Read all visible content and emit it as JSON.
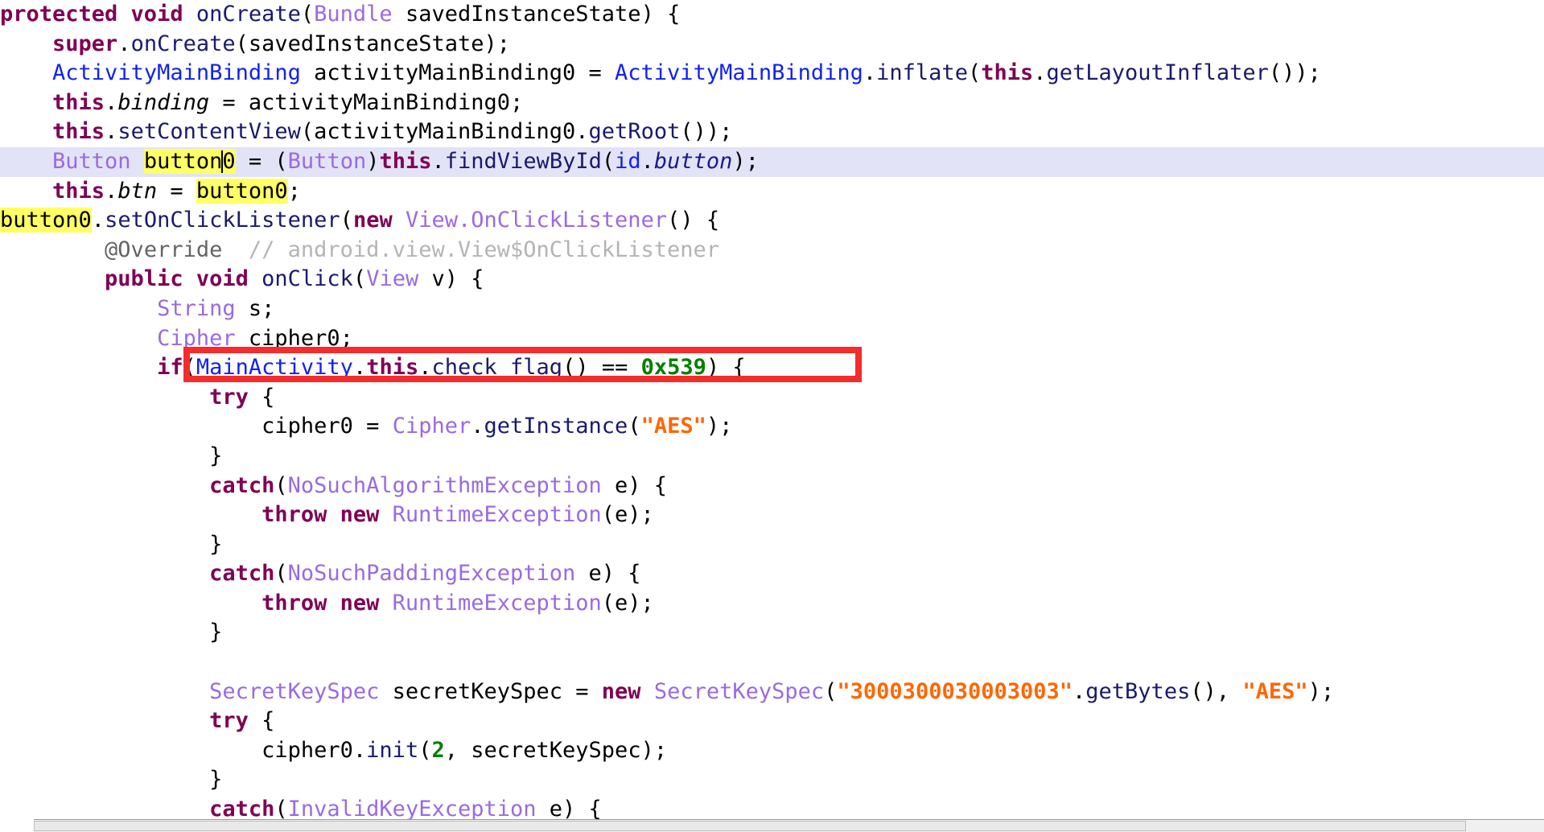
{
  "viewer": {
    "kind": "decompiled-java-source-view",
    "language": "Java",
    "background_color": "#ffffff",
    "current_line_highlight_color": "#e3e3f7",
    "occurrence_highlight_color": "#ffff66",
    "annotation_box_color": "#f42c2c"
  },
  "annotation": {
    "shape": "rectangle",
    "color": "#f42c2c",
    "targets_line_index": 12,
    "target_text": "if(MainActivity.this.check_flag() == 0x539) {"
  },
  "code": {
    "lines": [
      {
        "index": 0,
        "text": "protected void onCreate(Bundle savedInstanceState) {"
      },
      {
        "index": 1,
        "text": "    super.onCreate(savedInstanceState);"
      },
      {
        "index": 2,
        "text": "    ActivityMainBinding activityMainBinding0 = ActivityMainBinding.inflate(this.getLayoutInflater());"
      },
      {
        "index": 3,
        "text": "    this.binding = activityMainBinding0;"
      },
      {
        "index": 4,
        "text": "    this.setContentView(activityMainBinding0.getRoot());"
      },
      {
        "index": 5,
        "text": "    Button button0 = (Button)this.findViewById(id.button);",
        "current": true
      },
      {
        "index": 6,
        "text": "    this.btn = button0;"
      },
      {
        "index": 7,
        "text": "    button0.setOnClickListener(new View.OnClickListener() {"
      },
      {
        "index": 8,
        "text": "        @Override  // android.view.View$OnClickListener"
      },
      {
        "index": 9,
        "text": "        public void onClick(View v) {"
      },
      {
        "index": 10,
        "text": "            String s;"
      },
      {
        "index": 11,
        "text": "            Cipher cipher0;"
      },
      {
        "index": 12,
        "text": "            if(MainActivity.this.check_flag() == 0x539) {"
      },
      {
        "index": 13,
        "text": "                try {"
      },
      {
        "index": 14,
        "text": "                    cipher0 = Cipher.getInstance(\"AES\");"
      },
      {
        "index": 15,
        "text": "                }"
      },
      {
        "index": 16,
        "text": "                catch(NoSuchAlgorithmException e) {"
      },
      {
        "index": 17,
        "text": "                    throw new RuntimeException(e);"
      },
      {
        "index": 18,
        "text": "                }"
      },
      {
        "index": 19,
        "text": "                catch(NoSuchPaddingException e) {"
      },
      {
        "index": 20,
        "text": "                    throw new RuntimeException(e);"
      },
      {
        "index": 21,
        "text": "                }"
      },
      {
        "index": 22,
        "text": ""
      },
      {
        "index": 23,
        "text": "                SecretKeySpec secretKeySpec = new SecretKeySpec(\"3000300030003003\".getBytes(), \"AES\");"
      },
      {
        "index": 24,
        "text": "                try {"
      },
      {
        "index": 25,
        "text": "                    cipher0.init(2, secretKeySpec);"
      },
      {
        "index": 26,
        "text": "                }"
      },
      {
        "index": 27,
        "text": "                catch(InvalidKeyException e) {"
      }
    ],
    "occurrence_highlight_token": "button0",
    "caret_token": "button0",
    "caret_offset_in_token": 6,
    "literals": {
      "flag_check_constant": "0x539",
      "aes_algorithm": "AES",
      "secret_key": "3000300030003003",
      "cipher_init_mode": "2"
    },
    "identifiers": {
      "method": "onCreate",
      "parameter": "savedInstanceState",
      "binding_type": "ActivityMainBinding",
      "binding_var": "activityMainBinding0",
      "field_binding": "binding",
      "field_btn": "btn",
      "button_var": "button0",
      "view_id": "id.button",
      "listener_type": "View.OnClickListener",
      "override_comment": "// android.view.View$OnClickListener",
      "activity_class": "MainActivity",
      "flag_method": "check_flag",
      "cipher_var": "cipher0",
      "secret_key_spec_var": "secretKeySpec"
    }
  },
  "scrollbar": {
    "orientation": "horizontal",
    "position": "bottom",
    "thumb_fraction": "0.95"
  }
}
